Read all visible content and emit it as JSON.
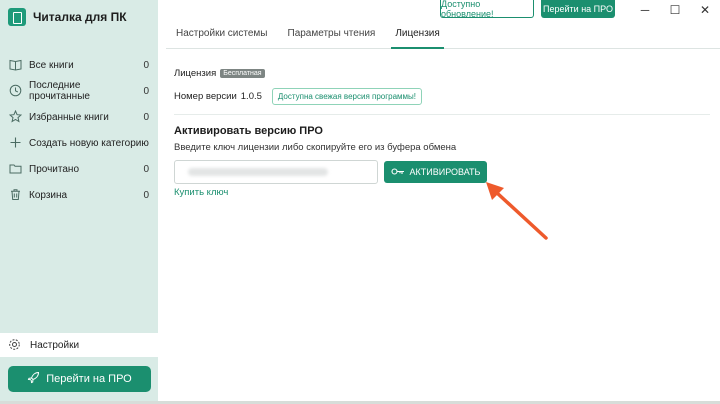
{
  "app": {
    "title": "Читалка для ПК",
    "update_button": "Доступно обновление!",
    "go_pro_top": "Перейти на ПРО",
    "minimize": "─",
    "maximize": "☐",
    "close": "✕"
  },
  "sidebar": {
    "items": [
      {
        "label": "Все книги",
        "count": "0",
        "icon": "books-icon"
      },
      {
        "label": "Последние прочитанные",
        "count": "0",
        "icon": "clock-icon"
      },
      {
        "label": "Избранные книги",
        "count": "0",
        "icon": "star-icon"
      },
      {
        "label": "Создать новую категорию",
        "count": "",
        "icon": "plus-icon"
      },
      {
        "label": "Прочитано",
        "count": "0",
        "icon": "folder-icon"
      },
      {
        "label": "Корзина",
        "count": "0",
        "icon": "trash-icon"
      }
    ],
    "settings_label": "Настройки",
    "pro_button": "Перейти на ПРО"
  },
  "tabs": [
    "Настройки системы",
    "Параметры чтения",
    "Лицензия"
  ],
  "active_tab": 2,
  "license": {
    "label": "Лицензия",
    "badge": "Бесплатная",
    "version_label": "Номер версии",
    "version": "1.0.5",
    "update_notice": "Доступна свежая версия программы!",
    "activate_title": "Активировать версию ПРО",
    "hint": "Введите ключ лицензии либо скопируйте его из буфера обмена",
    "input_value": "",
    "activate_button": "АКТИВИРОВАТЬ",
    "buy_link": "Купить ключ"
  },
  "colors": {
    "accent": "#1b8f6f",
    "sidebar_bg": "#d9ebe6",
    "arrow": "#ee5a2c"
  }
}
